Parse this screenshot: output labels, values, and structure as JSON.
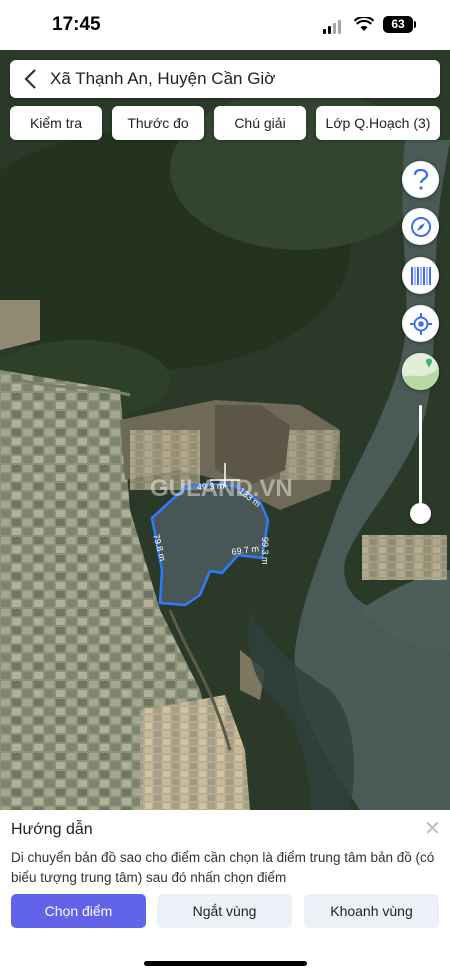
{
  "status": {
    "time": "17:45",
    "battery": "63"
  },
  "header": {
    "title": "Xã Thạnh An, Huyện Cần Giờ"
  },
  "toolbar": {
    "chips": [
      "Kiểm tra",
      "Thước đo",
      "Chú giải",
      "Lớp Q.Hoạch (3)"
    ]
  },
  "map": {
    "watermark": "GULAND.VN",
    "measurements": [
      "49.3 m",
      "133 m",
      "99.3 m",
      "69.7 m",
      "79.8 m"
    ],
    "boundary_color": "#2f7bff"
  },
  "panel": {
    "title": "Hướng dẫn",
    "description": "Di chuyển bản đồ sao cho điểm cần chọn là điểm trung tâm bản đồ (có biểu tượng trung tâm) sau đó nhấn chọn điểm",
    "buttons": {
      "select": "Chọn điểm",
      "cut": "Ngắt vùng",
      "area": "Khoanh vùng"
    }
  },
  "colors": {
    "accent": "#6163e8",
    "icon_blue": "#3f6ff0"
  }
}
